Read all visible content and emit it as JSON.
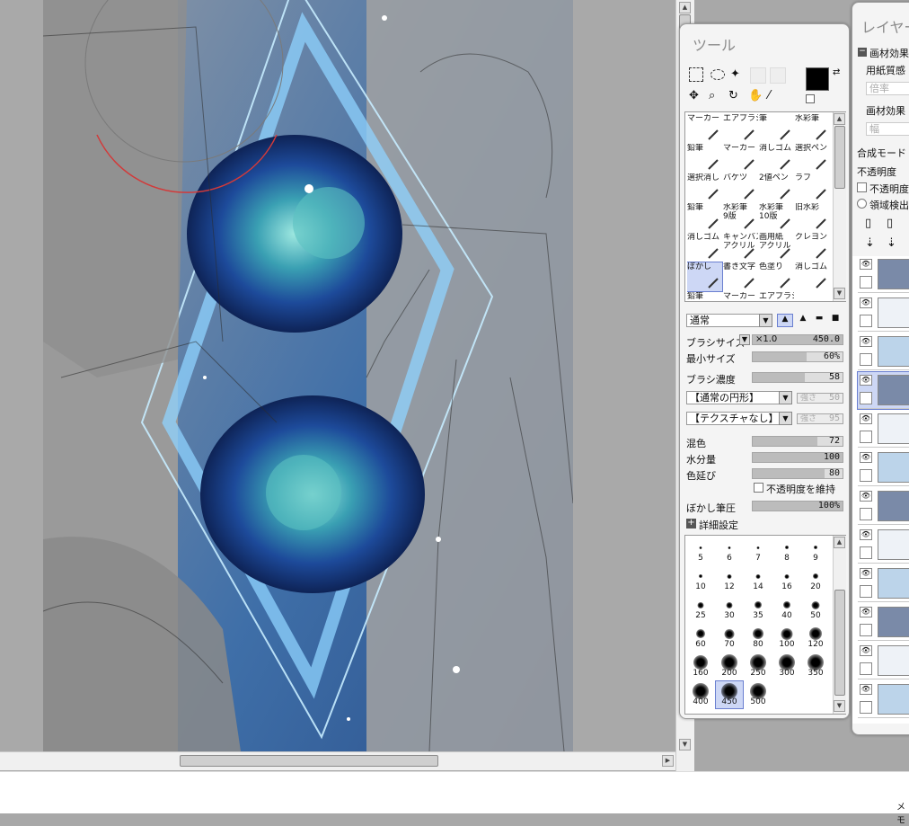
{
  "tool_panel": {
    "title": "ツール",
    "tools": [
      {
        "label": "マーカー",
        "icon": "marker-icon"
      },
      {
        "label": "エアブラシ",
        "icon": "airbrush-icon"
      },
      {
        "label": "筆",
        "icon": "brush-icon"
      },
      {
        "label": "水彩筆",
        "icon": "watercolor-icon"
      },
      {
        "label": "鉛筆",
        "icon": "pencil-icon"
      },
      {
        "label": "マーカー",
        "icon": "marker-icon"
      },
      {
        "label": "消しゴム",
        "icon": "eraser-icon"
      },
      {
        "label": "選択ペン",
        "icon": "select-pen-icon"
      },
      {
        "label": "選択消し",
        "icon": "select-eraser-icon"
      },
      {
        "label": "バケツ",
        "icon": "bucket-icon"
      },
      {
        "label": "2値ペン",
        "icon": "binary-pen-icon"
      },
      {
        "label": "ラフ",
        "icon": "rough-icon"
      },
      {
        "label": "鉛筆",
        "icon": "pencil-icon"
      },
      {
        "label": "水彩筆\n9版",
        "icon": "watercolor-icon"
      },
      {
        "label": "水彩筆\n10版",
        "icon": "watercolor-icon"
      },
      {
        "label": "旧水彩",
        "icon": "watercolor-icon"
      },
      {
        "label": "消しゴム",
        "icon": "eraser-icon"
      },
      {
        "label": "キャンバス\nアクリル",
        "icon": "acrylic-icon"
      },
      {
        "label": "画用紙\nアクリル",
        "icon": "acrylic-icon"
      },
      {
        "label": "クレヨン",
        "icon": "crayon-icon"
      },
      {
        "label": "ぼかし",
        "icon": "blur-icon"
      },
      {
        "label": "書き文字",
        "icon": "writing-icon"
      },
      {
        "label": "色塗り",
        "icon": "paint-icon"
      },
      {
        "label": "消しゴム",
        "icon": "eraser-icon"
      },
      {
        "label": "鉛筆",
        "icon": "pencil-icon"
      },
      {
        "label": "マーカー",
        "icon": "marker-icon"
      },
      {
        "label": "エアブラシ",
        "icon": "airbrush-icon"
      }
    ],
    "selected_tool_index": 20,
    "blend_mode": "通常",
    "brush_size_label": "ブラシサイズ",
    "brush_size_multiplier": "×1.0",
    "brush_size_value": "450.0",
    "min_size_label": "最小サイズ",
    "min_size_value": "60%",
    "min_size_fraction": 0.6,
    "brush_density_label": "ブラシ濃度",
    "brush_density_value": "58",
    "brush_density_fraction": 0.58,
    "shape_select": "【通常の円形】",
    "shape_strength_label": "強さ",
    "shape_strength_value": "50",
    "texture_select": "【テクスチャなし】",
    "texture_strength_label": "強さ",
    "texture_strength_value": "95",
    "mix_label": "混色",
    "mix_value": "72",
    "mix_fraction": 0.72,
    "water_label": "水分量",
    "water_value": "100",
    "water_fraction": 1.0,
    "stretch_label": "色延び",
    "stretch_value": "80",
    "stretch_fraction": 0.8,
    "keep_opacity_label": "不透明度を維持",
    "blur_pressure_label": "ぼかし筆圧",
    "blur_pressure_value": "100%",
    "blur_pressure_fraction": 1.0,
    "detail_label": "詳細設定",
    "brush_sizes": [
      "5",
      "6",
      "7",
      "8",
      "9",
      "10",
      "12",
      "14",
      "16",
      "20",
      "25",
      "30",
      "35",
      "40",
      "50",
      "60",
      "70",
      "80",
      "100",
      "120",
      "160",
      "200",
      "250",
      "300",
      "350",
      "400",
      "450",
      "500"
    ],
    "selected_brush_size": "450",
    "primary_color": "#000000",
    "secondary_color": "#ffffff"
  },
  "layer_panel": {
    "title": "レイヤー",
    "material_effect": "画材効果",
    "paper_texture": "用紙質感",
    "paper_value": "倍率",
    "material_value_label": "画材効果",
    "material_width": "幅",
    "blend_mode_label": "合成モード",
    "opacity_label": "不透明度",
    "opacity_protect_label": "不透明度",
    "area_detect_label": "領域検出"
  },
  "status": {
    "memo_label": "メモ"
  }
}
